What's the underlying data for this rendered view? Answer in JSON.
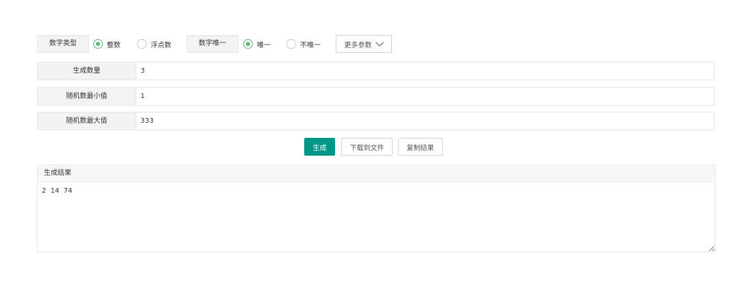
{
  "options": {
    "number_type": {
      "label": "数字类型",
      "choices": [
        {
          "label": "整数",
          "checked": true
        },
        {
          "label": "浮点数",
          "checked": false
        }
      ]
    },
    "unique": {
      "label": "数字唯一",
      "choices": [
        {
          "label": "唯一",
          "checked": true
        },
        {
          "label": "不唯一",
          "checked": false
        }
      ]
    },
    "more_params_label": "更多参数"
  },
  "fields": {
    "count": {
      "label": "生成数量",
      "value": "3"
    },
    "min": {
      "label": "随机数最小值",
      "value": "1"
    },
    "max": {
      "label": "随机数最大值",
      "value": "333"
    }
  },
  "actions": {
    "generate_label": "生成",
    "download_label": "下载到文件",
    "copy_label": "复制结果"
  },
  "result": {
    "title": "生成结果",
    "value": "2  14  74"
  },
  "colors": {
    "primary": "#009688",
    "radio_checked": "#5fb878"
  },
  "icons": {
    "more_params": "chevron-down-icon"
  }
}
